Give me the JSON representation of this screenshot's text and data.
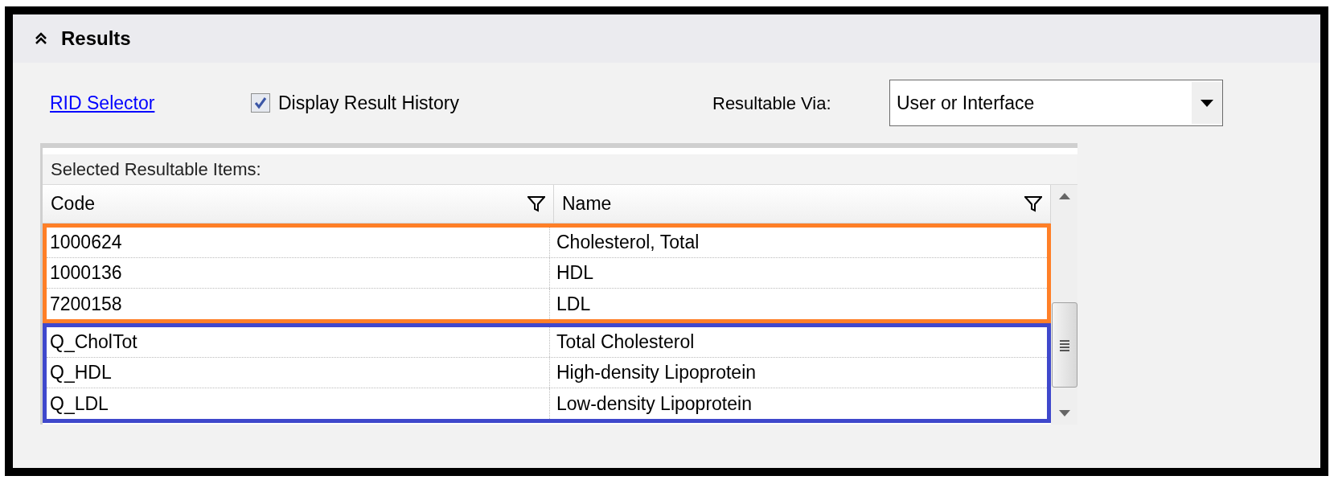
{
  "section": {
    "title": "Results",
    "expanded": true
  },
  "controls": {
    "link": "RID Selector",
    "checkbox": {
      "label": "Display Result History",
      "checked": true
    },
    "dropdown": {
      "label": "Resultable Via:",
      "value": "User or Interface"
    }
  },
  "grid": {
    "caption": "Selected Resultable Items:",
    "columns": [
      "Code",
      "Name"
    ],
    "groups": [
      {
        "color": "#ff7f27",
        "rows": [
          [
            "1000624",
            "Cholesterol, Total"
          ],
          [
            "1000136",
            "HDL"
          ],
          [
            "7200158",
            "LDL"
          ]
        ]
      },
      {
        "color": "#3f48cc",
        "rows": [
          [
            "Q_CholTot",
            "Total Cholesterol"
          ],
          [
            "Q_HDL",
            "High-density Lipoprotein"
          ],
          [
            "Q_LDL",
            "Low-density Lipoprotein"
          ]
        ]
      }
    ]
  }
}
